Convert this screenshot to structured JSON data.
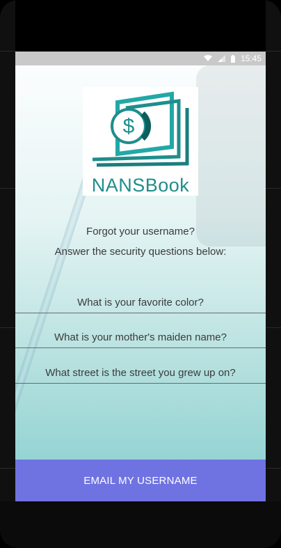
{
  "status_bar": {
    "time": "15:45",
    "icons": [
      "wifi-icon",
      "signal-icon",
      "battery-icon"
    ]
  },
  "logo": {
    "text": "NANSBook",
    "icon": "dollar-bill-icon",
    "color": "#1e8e8c"
  },
  "prompt": {
    "line1": "Forgot your username?",
    "line2": "Answer the security questions below:"
  },
  "security_questions": [
    {
      "placeholder": "What is your favorite color?"
    },
    {
      "placeholder": "What is your mother's maiden name?"
    },
    {
      "placeholder": "What street is the street you grew up on?"
    }
  ],
  "actions": {
    "email_username": "EMAIL MY USERNAME",
    "button_color": "#6f73e2"
  }
}
